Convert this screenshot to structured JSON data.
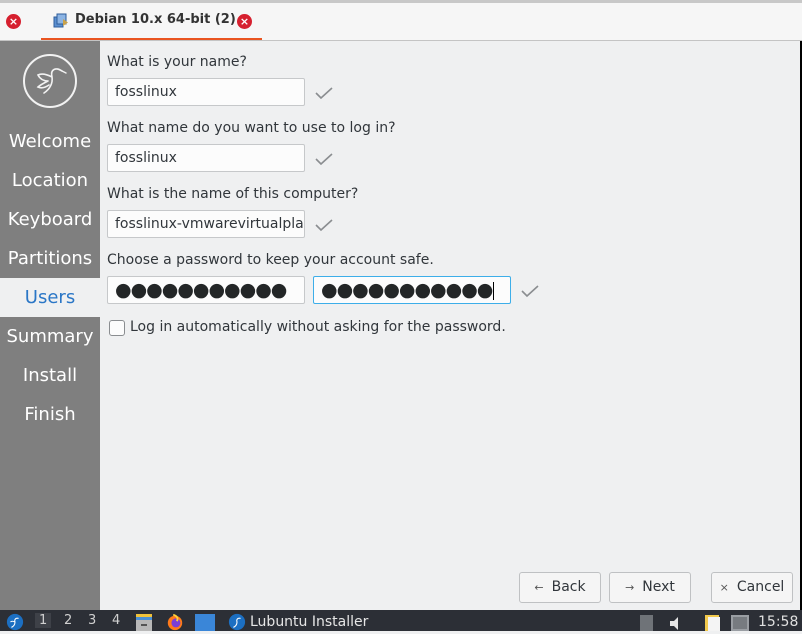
{
  "vm_tabbar": {
    "tab_title": "Debian 10.x 64-bit (2)",
    "close_left_icon": "close-circle-icon",
    "tab_close_icon": "close-circle-icon",
    "vm_icon": "vm-icon",
    "accent_color": "#e95420"
  },
  "sidebar": {
    "logo_icon": "lubuntu-bird-logo",
    "steps": [
      {
        "label": "Welcome",
        "active": false
      },
      {
        "label": "Location",
        "active": false
      },
      {
        "label": "Keyboard",
        "active": false
      },
      {
        "label": "Partitions",
        "active": false
      },
      {
        "label": "Users",
        "active": true
      },
      {
        "label": "Summary",
        "active": false
      },
      {
        "label": "Install",
        "active": false
      },
      {
        "label": "Finish",
        "active": false
      }
    ],
    "active_color": "#2a76c6"
  },
  "form": {
    "name_label": "What is your name?",
    "name_value": "fosslinux",
    "login_label": "What name do you want to use to log in?",
    "login_value": "fosslinux",
    "computer_label": "What is the name of this computer?",
    "computer_value": "fosslinux-vmwarevirtualplat",
    "password_label": "Choose a password to keep your account safe.",
    "password_value": "●●●●●●●●●●●",
    "password_confirm_value": "●●●●●●●●●●●",
    "autologin_label": "Log in automatically without asking for the password.",
    "autologin_checked": false,
    "valid_icon": "checkmark-icon"
  },
  "buttons": {
    "back_label": "Back",
    "back_icon": "←",
    "next_label": "Next",
    "next_icon": "→",
    "cancel_label": "Cancel",
    "cancel_icon": "×"
  },
  "taskbar": {
    "start_icon": "lubuntu-start-icon",
    "desktops": [
      "1",
      "2",
      "3",
      "4"
    ],
    "active_desktop": "1",
    "launchers": [
      "file-manager-icon",
      "firefox-icon",
      "desktop-icon"
    ],
    "window_title": "Lubuntu Installer",
    "tray": [
      "eject-icon",
      "volume-icon",
      "clipboard-icon",
      "network-icon"
    ],
    "clock": "15:58"
  }
}
